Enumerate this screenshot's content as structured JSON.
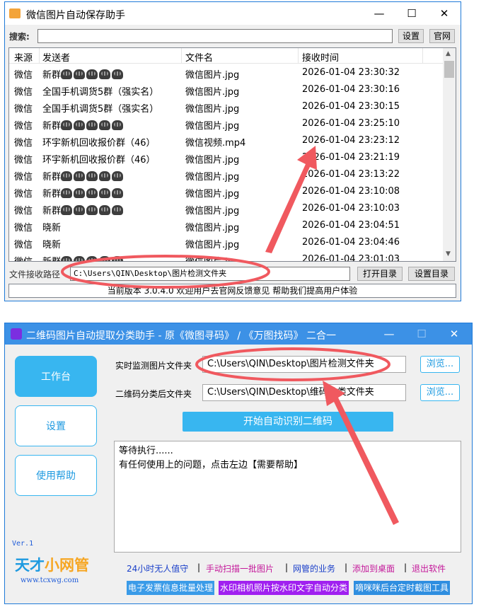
{
  "window1": {
    "title": "微信图片自动保存助手",
    "controls": {
      "minimize": "—",
      "maximize": "☐",
      "close": "✕"
    },
    "search": {
      "label": "搜索:",
      "value": "",
      "settings_label": "设置",
      "official_label": "官网"
    },
    "table": {
      "headers": [
        "来源",
        "发送者",
        "文件名",
        "接收时间"
      ],
      "rows": [
        {
          "source": "微信",
          "sender": "新群",
          "emoji": 5,
          "file": "微信图片.jpg",
          "time": "2026-01-04 23:30:32"
        },
        {
          "source": "微信",
          "sender": "全国手机调货5群（强实名）",
          "emoji": 0,
          "file": "微信图片.jpg",
          "time": "2026-01-04 23:30:16"
        },
        {
          "source": "微信",
          "sender": "全国手机调货5群（强实名）",
          "emoji": 0,
          "file": "微信图片.jpg",
          "time": "2026-01-04 23:30:15"
        },
        {
          "source": "微信",
          "sender": "新群",
          "emoji": 5,
          "file": "微信图片.jpg",
          "time": "2026-01-04 23:25:10"
        },
        {
          "source": "微信",
          "sender": "环宇新机回收报价群（46）",
          "emoji": 0,
          "file": "微信视频.mp4",
          "time": "2026-01-04 23:23:12"
        },
        {
          "source": "微信",
          "sender": "环宇新机回收报价群（46）",
          "emoji": 0,
          "file": "微信图片.jpg",
          "time": "2026-01-04 23:21:19"
        },
        {
          "source": "微信",
          "sender": "新群",
          "emoji": 5,
          "file": "微信图片.jpg",
          "time": "2026-01-04 23:13:22"
        },
        {
          "source": "微信",
          "sender": "新群",
          "emoji": 5,
          "file": "微信图片.jpg",
          "time": "2026-01-04 23:10:08"
        },
        {
          "source": "微信",
          "sender": "新群",
          "emoji": 5,
          "file": "微信图片.jpg",
          "time": "2026-01-04 23:10:03"
        },
        {
          "source": "微信",
          "sender": "晓新",
          "emoji": 0,
          "file": "微信图片.jpg",
          "time": "2026-01-04 23:04:51"
        },
        {
          "source": "微信",
          "sender": "晓新",
          "emoji": 0,
          "file": "微信图片.jpg",
          "time": "2026-01-04 23:04:46"
        },
        {
          "source": "微信",
          "sender": "新群",
          "emoji": 5,
          "file": "微信图片.jpg",
          "time": "2026-01-04 23:01:03"
        }
      ]
    },
    "path": {
      "label": "文件接收路径",
      "value": "C:\\Users\\QIN\\Desktop\\图片检测文件夹",
      "open_label": "打开目录",
      "set_label": "设置目录"
    },
    "status": "当前版本 3.0.4.0 欢迎用户去官网反馈意见 帮助我们提高用户体验"
  },
  "window2": {
    "title": "二维码图片自动提取分类助手 - 原《微图寻码》 / 《万图找码》 二合一",
    "controls": {
      "minimize": "—",
      "maximize": "☐",
      "close": "✕"
    },
    "nav": [
      "工作台",
      "设置",
      "使用帮助"
    ],
    "version": "Ver.1",
    "logo": {
      "text1": "天才",
      "text2": "小网管",
      "url": "www.tcxwg.com"
    },
    "monitor": {
      "label": "实时监测图片文件夹",
      "value": "C:\\Users\\QIN\\Desktop\\图片检测文件夹",
      "browse": "浏览..."
    },
    "classify": {
      "label": "二维码分类后文件夹",
      "value": "C:\\Users\\QIN\\Desktop\\维码分类文件夹",
      "browse": "浏览..."
    },
    "start_label": "开始自动识别二维码",
    "log": [
      "等待执行......",
      "有任何使用上的问题，点击左边【需要帮助】"
    ],
    "links": [
      "24小时无人值守",
      "手动扫描一批图片",
      "网管的业务",
      "添加到桌面",
      "退出软件"
    ],
    "link_separator": "|",
    "tags": [
      "电子发票信息批量处理",
      "水印相机照片按水印文字自动分类",
      "嘀咪咪后台定时截图工具"
    ],
    "colors": {
      "accent": "#38b6f0",
      "title_bar": "#3c91e6",
      "annotation": "#f0595f",
      "tag1": "#3a9be8",
      "tag2": "#a020f0",
      "tag3": "#2f8ee0"
    }
  }
}
